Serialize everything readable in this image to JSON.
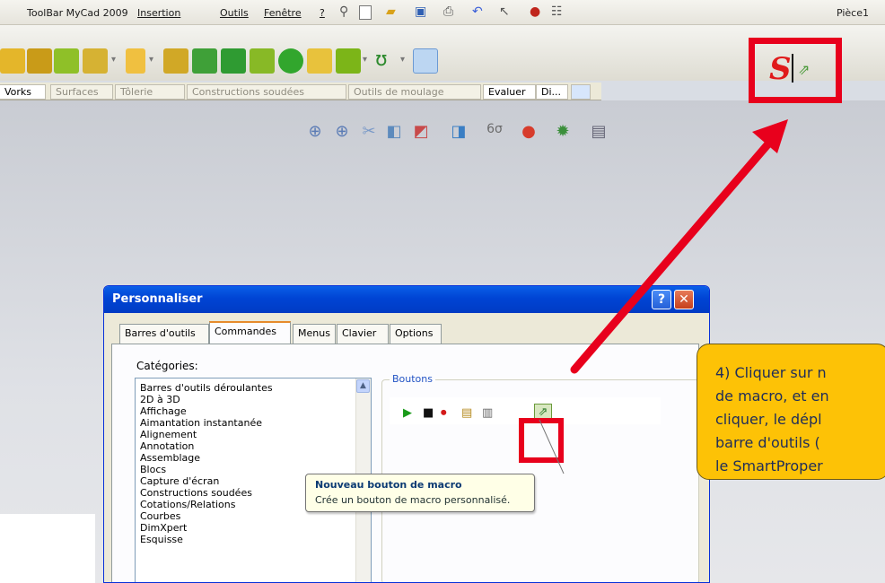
{
  "menubar": {
    "items": [
      "ToolBar MyCad 2009",
      "Insertion",
      "Outils",
      "Fenêtre",
      "?"
    ],
    "doc_title": "Pièce1"
  },
  "tabs_row": {
    "tabs": [
      "Vorks",
      "Surfaces",
      "Tôlerie",
      "Constructions soudées",
      "Outils de moulage",
      "Evaluer",
      "Di..."
    ]
  },
  "dialog": {
    "title": "Personnaliser",
    "help_label": "?",
    "close_label": "✕",
    "tabs": [
      "Barres d'outils",
      "Commandes",
      "Menus",
      "Clavier",
      "Options"
    ],
    "active_tab": "Commandes",
    "categories_label": "Catégories:",
    "categories": [
      "Barres d'outils déroulantes",
      "2D à 3D",
      "Affichage",
      "Aimantation instantanée",
      "Alignement",
      "Annotation",
      "Assemblage",
      "Blocs",
      "Capture d'écran",
      "Constructions soudées",
      "Cotations/Relations",
      "Courbes",
      "DimXpert",
      "Esquisse"
    ],
    "buttons_label": "Boutons"
  },
  "tooltip": {
    "title": "Nouveau bouton de macro",
    "text": "Crée un bouton de macro personnalisé."
  },
  "callout": {
    "lines": [
      "4) Cliquer sur n",
      "de macro, et en",
      "cliquer, le dépl",
      "barre d'outils (",
      "le SmartProper"
    ]
  },
  "colors": {
    "highlight": "#e8001c",
    "callout": "#fdc206",
    "title_bar": "#0044d4"
  }
}
